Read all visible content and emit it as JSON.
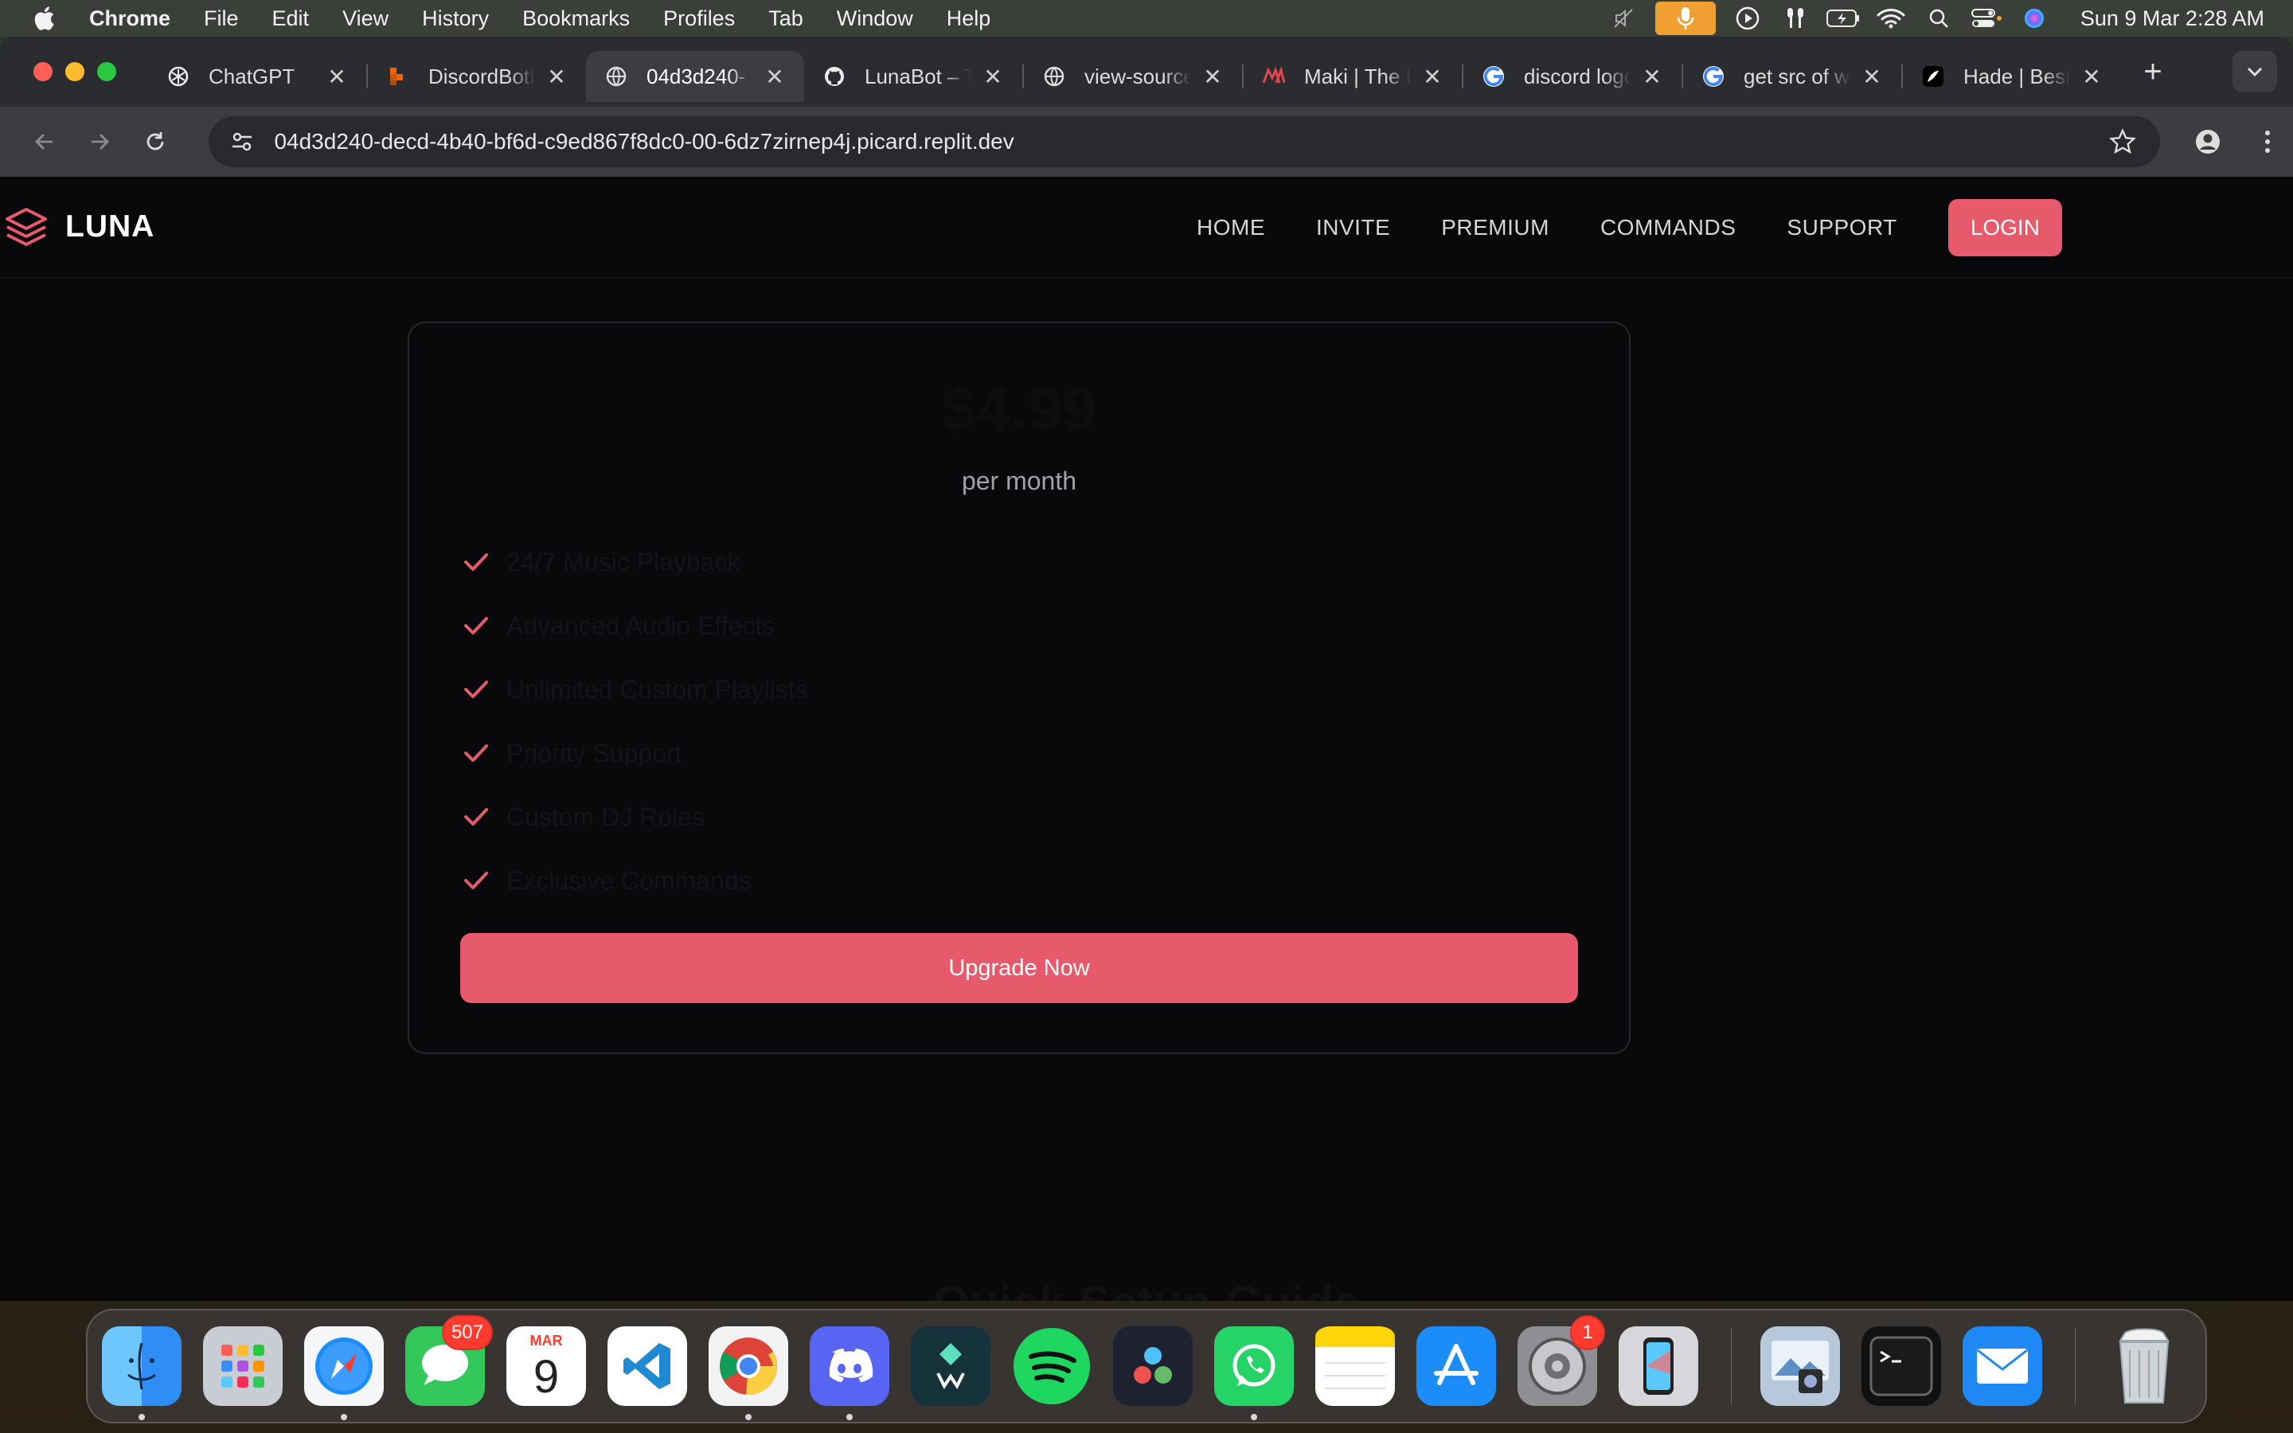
{
  "menubar": {
    "app_name": "Chrome",
    "menus": [
      "File",
      "Edit",
      "View",
      "History",
      "Bookmarks",
      "Profiles",
      "Tab",
      "Window",
      "Help"
    ],
    "status_icons": [
      "mute-icon",
      "microphone-icon",
      "play-icon",
      "airpods-icon",
      "battery-icon",
      "wifi-icon",
      "spotlight-search-icon",
      "control-center-icon",
      "siri-icon"
    ],
    "clock": "Sun 9 Mar  2:28 AM"
  },
  "browser": {
    "tabs": [
      {
        "title": "ChatGPT",
        "icon": "chatgpt-icon"
      },
      {
        "title": "DiscordBotL",
        "icon": "discordbot-icon"
      },
      {
        "title": "04d3d240-",
        "icon": "globe-icon",
        "active": true
      },
      {
        "title": "LunaBot – T",
        "icon": "github-icon"
      },
      {
        "title": "view-source",
        "icon": "globe-icon"
      },
      {
        "title": "Maki | The L",
        "icon": "maki-icon"
      },
      {
        "title": "discord logo",
        "icon": "google-icon"
      },
      {
        "title": "get src of w",
        "icon": "google-icon"
      },
      {
        "title": "Hade | Best",
        "icon": "hade-icon"
      }
    ],
    "url": "04d3d240-decd-4b40-bf6d-c9ed867f8dc0-00-6dz7zirnep4j.picard.replit.dev"
  },
  "site": {
    "brand": "LUNA",
    "nav": [
      "HOME",
      "INVITE",
      "PREMIUM",
      "COMMANDS",
      "SUPPORT"
    ],
    "login_label": "LOGIN",
    "accent_color": "#e65a6c",
    "card": {
      "price": "$4.99",
      "period": "per month",
      "features": [
        "24/7 Music Playback",
        "Advanced Audio Effects",
        "Unlimited Custom Playlists",
        "Priority Support",
        "Custom DJ Roles",
        "Exclusive Commands"
      ],
      "cta_label": "Upgrade Now"
    },
    "next_section_heading": "Quick Setup Guide"
  },
  "dock": {
    "messages_badge": "507",
    "calendar_month": "MAR",
    "calendar_day": "9",
    "settings_badge": "1"
  }
}
